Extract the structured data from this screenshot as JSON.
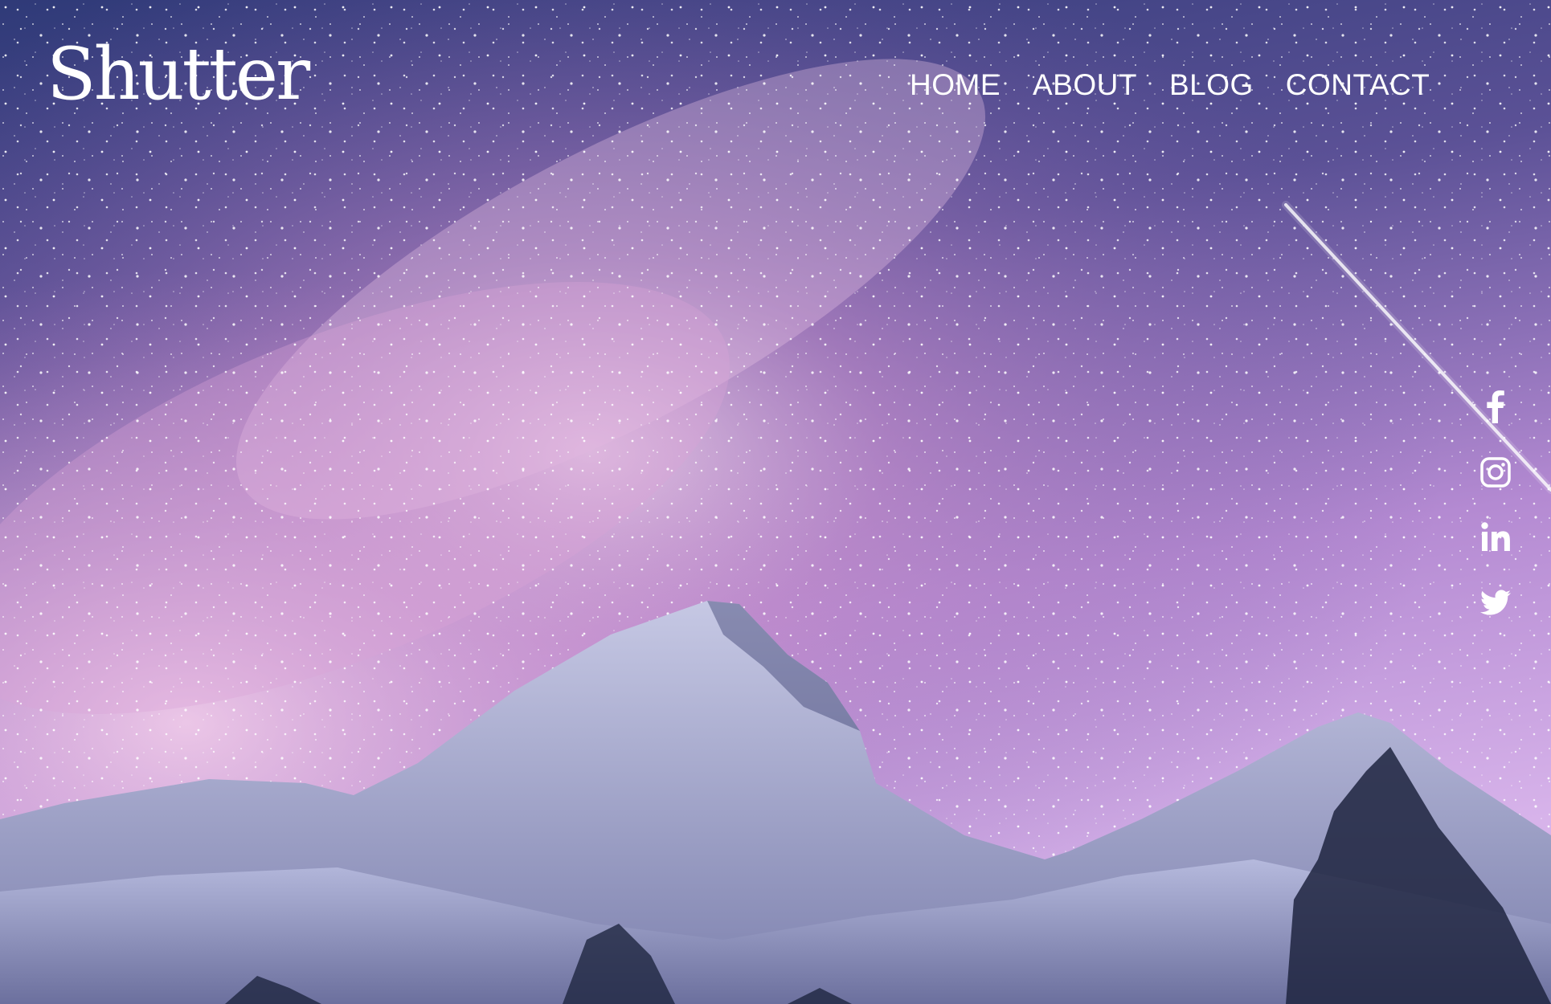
{
  "site": {
    "logo": "Shutter"
  },
  "nav": {
    "items": [
      {
        "label": "HOME"
      },
      {
        "label": "ABOUT"
      },
      {
        "label": "BLOG"
      },
      {
        "label": "CONTACT"
      }
    ]
  },
  "social": {
    "icons": [
      "facebook-icon",
      "instagram-icon",
      "linkedin-icon",
      "twitter-icon"
    ],
    "color": "#ffffff"
  },
  "colors": {
    "text": "#ffffff",
    "sky_top": "#3b4680",
    "sky_glow": "#d9a6e6",
    "snow": "#c9cbe6"
  }
}
